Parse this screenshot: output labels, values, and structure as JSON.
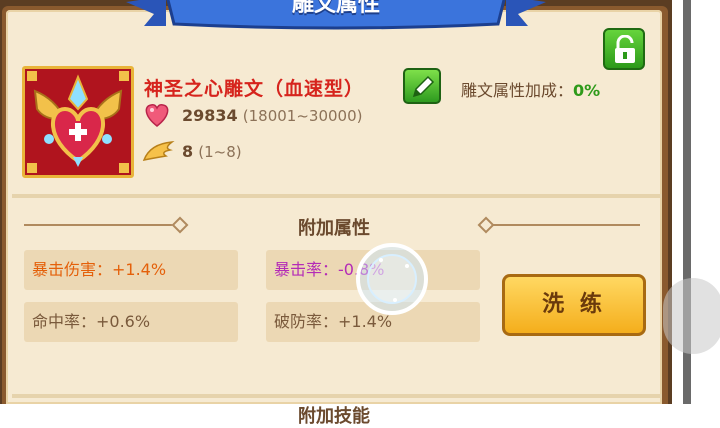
{
  "window": {
    "title": "雕文属性"
  },
  "item": {
    "name": "神圣之心雕文（血速型）",
    "bonus_label": "雕文属性加成：",
    "bonus_value": "0%",
    "hp_value": "29834",
    "hp_range": "(18001~30000)",
    "level_value": "8",
    "level_range": "(1~8)"
  },
  "extra_attributes": {
    "section_title": "附加属性",
    "items": [
      {
        "label": "暴击伤害：+1.4%",
        "color": "#e4600a"
      },
      {
        "label": "暴击率：",
        "value": "-0.8%",
        "color": "#b42bb7"
      },
      {
        "label": "命中率：+0.6%",
        "color": "#7a5a3c"
      },
      {
        "label": "破防率：+1.4%",
        "color": "#7a5a3c"
      }
    ]
  },
  "refine_button": {
    "label": "洗 练"
  },
  "next_section": {
    "title": "附加技能"
  },
  "icons": {
    "lock": "unlock-icon",
    "edit": "pencil-icon",
    "hp": "heart-icon",
    "level": "wing-icon",
    "item": "sacred-heart-glyph-icon"
  },
  "colors": {
    "item_name": "#d6241d",
    "bonus_value": "#2e9a1a",
    "button": "#f4ae1c",
    "banner": "#2f62c8"
  }
}
